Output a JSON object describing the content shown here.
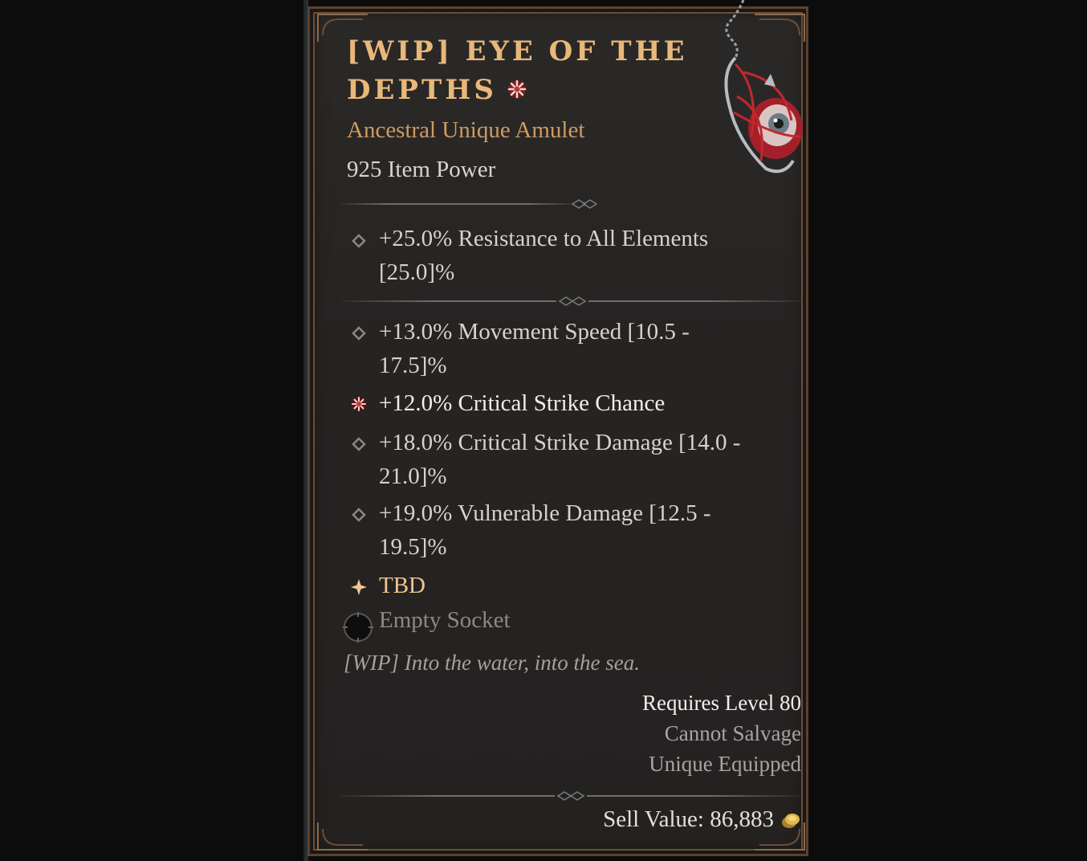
{
  "item": {
    "title_line1": "[WIP] EYE OF THE",
    "title_line2": "DEPTHS",
    "type": "Ancestral Unique Amulet",
    "item_power": "925 Item Power"
  },
  "implicit": {
    "line1": "+25.0% Resistance to All Elements",
    "line2": "[25.0]%"
  },
  "affixes": [
    {
      "line1": "+13.0% Movement Speed [10.5 -",
      "line2": "17.5]%"
    },
    {
      "line1": "+12.0% Critical Strike Chance"
    },
    {
      "line1": "+18.0% Critical Strike Damage [14.0 -",
      "line2": "21.0]%"
    },
    {
      "line1": "+19.0% Vulnerable Damage [12.5 -",
      "line2": "19.5]%"
    },
    {
      "line1": "TBD"
    }
  ],
  "socket": "Empty Socket",
  "flavor": "[WIP] Into the water, into the sea.",
  "requirements": {
    "level": "Requires Level 80",
    "salvage": "Cannot Salvage",
    "unique": "Unique Equipped"
  },
  "sell_value": "Sell Value: 86,883",
  "colors": {
    "title": "#e8b77a",
    "unique_type": "#cf9a62",
    "text": "#d6d2cc",
    "greater_affix": "#c0392b",
    "unique_power": "#f0c690"
  },
  "icons": {
    "ancestral": "ancestral-star-icon",
    "affix_bullet": "diamond-bullet-icon",
    "greater_affix": "greater-affix-icon",
    "unique_power": "unique-power-icon",
    "socket": "empty-socket-icon",
    "gold": "gold-coin-icon"
  }
}
